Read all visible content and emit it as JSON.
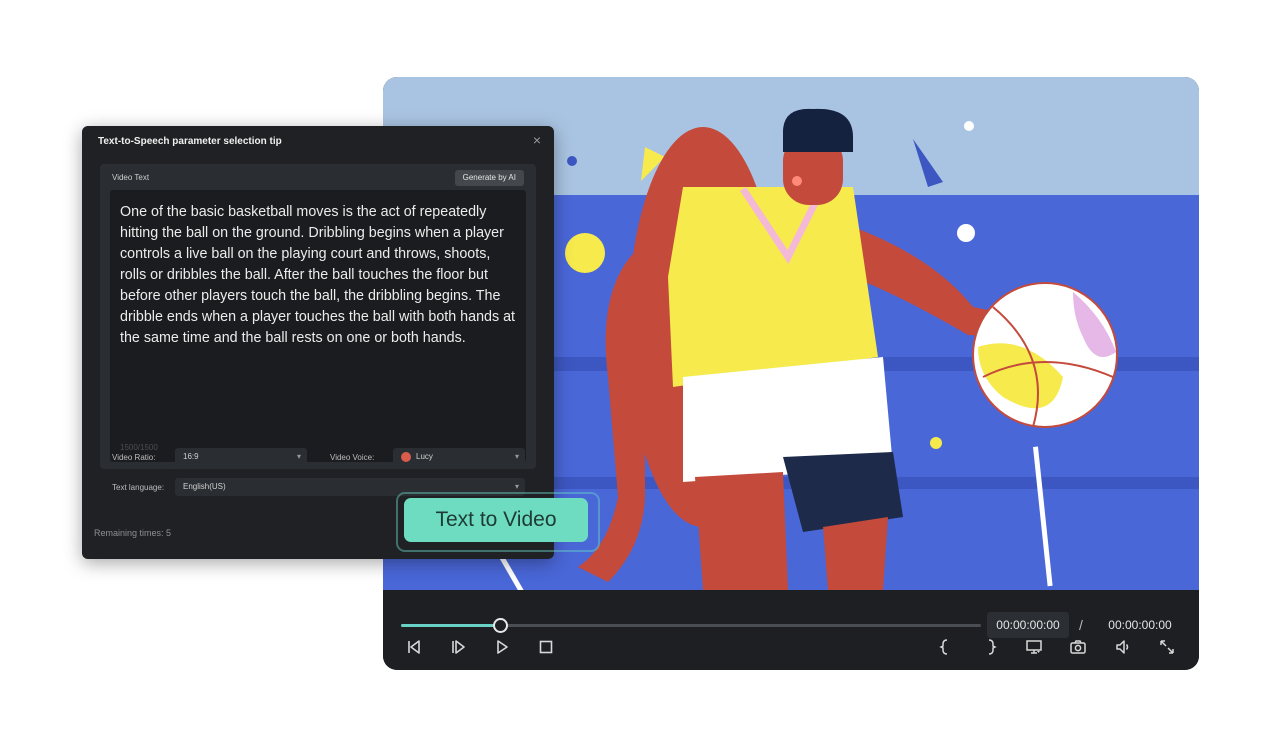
{
  "dialog": {
    "title": "Text-to-Speech parameter selection tip",
    "close_label": "×",
    "video_text_label": "Video Text",
    "generate_button": "Generate by AI",
    "video_text": "One of the basic basketball moves is the act of repeatedly hitting the ball on the ground. Dribbling begins when a player controls a live ball on the playing court and throws, shoots, rolls or dribbles the ball. After the ball touches the floor but before other players touch the ball, the dribbling begins. The dribble ends when a player touches the ball with both hands at the same time and the ball rests on one or both hands.",
    "char_count": "1500/1500",
    "video_ratio_label": "Video Ratio:",
    "video_ratio_value": "16:9",
    "video_voice_label": "Video Voice:",
    "video_voice_value": "Lucy",
    "text_language_label": "Text language:",
    "text_language_value": "English(US)",
    "remaining_times": "Remaining times: 5"
  },
  "cta": {
    "label": "Text to Video"
  },
  "player": {
    "current_time": "00:00:00:00",
    "separator": "/",
    "total_time": "00:00:00:00",
    "progress": 0.17,
    "controls": [
      "prev-frame-icon",
      "next-frame-icon",
      "play-icon",
      "stop-icon",
      "mark-in-icon",
      "mark-out-icon",
      "display-icon",
      "snapshot-icon",
      "volume-icon",
      "fullscreen-icon"
    ]
  },
  "colors": {
    "accent": "#6ddcc0",
    "player_bg": "#1d1f23",
    "dialog_bg": "#1f2125",
    "scene_sky": "#a9c4e2",
    "scene_court": "#4a67d8"
  }
}
